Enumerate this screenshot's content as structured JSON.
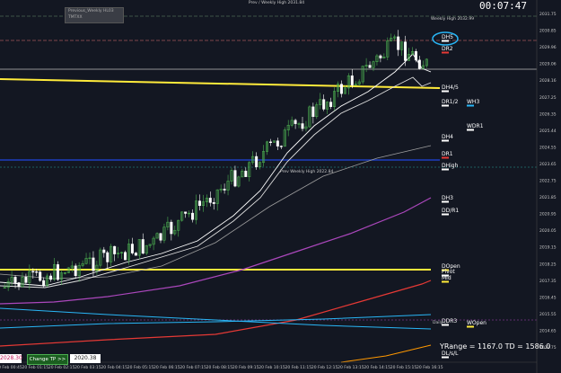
{
  "timer": "00:07:47",
  "legend": {
    "line1": "Previous_Weekly HL03",
    "line2": "TMTXX"
  },
  "top_label": "Prev / Weekly High 2031.84",
  "labels": {
    "weekly_high": "Weekly High 2032.99",
    "prev_weekly_high": "Prev Weekly High 2022.84",
    "daily_low": "Daily ...",
    "dh5": "DH5",
    "dr2": "DR2",
    "dh4_5": "DH4/5",
    "dr1_2": "DR1/2",
    "wh3": "WH3",
    "wdr1": "WDR1",
    "dh4": "DH4",
    "dr1": "DR1",
    "dhigh": "DHigh",
    "dh3": "DH3",
    "ddr1": "DD/R1",
    "dopen": "DOpen",
    "pivot": "Pivot",
    "mid": "Mid",
    "ddr3": "DDR3",
    "wopen": "WOpen",
    "ds_hl": "DL/s/L"
  },
  "price_axis": [
    "2031.75",
    "2030.85",
    "2029.96",
    "2029.06",
    "2028.16",
    "2027.25",
    "2026.35",
    "2025.44",
    "2024.55",
    "2023.65",
    "2022.75",
    "2021.85",
    "2020.95",
    "2020.05",
    "2019.15",
    "2018.25",
    "2017.35",
    "2016.45",
    "2015.55",
    "2014.65",
    "2013.75"
  ],
  "time_axis": [
    "20 Feb 00:45",
    "20 Feb 01:15",
    "20 Feb 02:15",
    "20 Feb 03:15",
    "20 Feb 04:15",
    "20 Feb 05:15",
    "20 Feb 06:15",
    "20 Feb 07:15",
    "20 Feb 08:15",
    "20 Feb 09:15",
    "20 Feb 10:15",
    "20 Feb 11:15",
    "20 Feb 12:15",
    "20 Feb 13:15",
    "20 Feb 14:15",
    "20 Feb 15:15",
    "20 Feb 16:15"
  ],
  "bottom": {
    "price_badge": "2028.30",
    "tp_button": "Change TP >>",
    "tp_value": "2020.38",
    "yrange": "YRange = 1167.0   TD = 1586.0"
  },
  "colors": {
    "background": "#131722",
    "bull": "#4caf50",
    "bear": "#ffffff",
    "yellow_level": "#ffeb3b",
    "blue_level": "#1e3fbf",
    "red_ma": "#e53935",
    "purple_ma": "#ab47bc",
    "cyan_line": "#29b6f6",
    "orange_line": "#ff9800"
  }
}
